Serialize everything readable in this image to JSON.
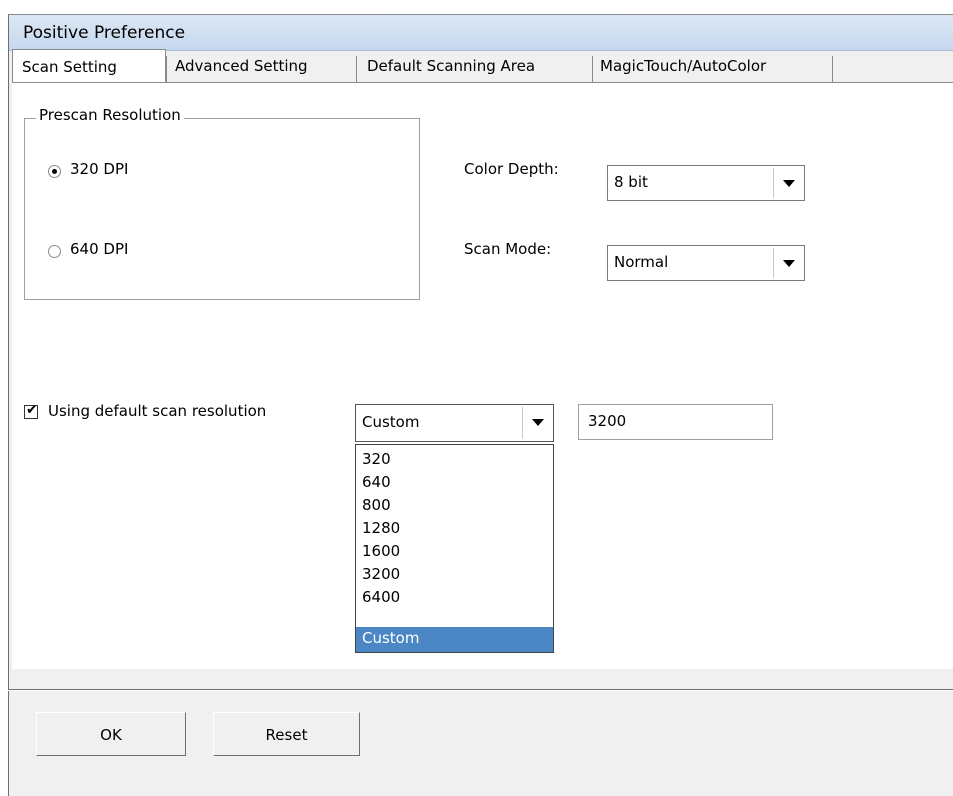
{
  "window": {
    "title": "Positive Preference"
  },
  "tabs": [
    {
      "label": "Scan Setting",
      "active": true
    },
    {
      "label": "Advanced Setting",
      "active": false
    },
    {
      "label": "Default Scanning Area",
      "active": false
    },
    {
      "label": "MagicTouch/AutoColor",
      "active": false
    }
  ],
  "prescan": {
    "group_label": "Prescan Resolution",
    "options": [
      {
        "label": "320 DPI",
        "selected": true
      },
      {
        "label": "640 DPI",
        "selected": false
      }
    ]
  },
  "color_depth": {
    "label": "Color Depth:",
    "value": "8 bit"
  },
  "scan_mode": {
    "label": "Scan Mode:",
    "value": "Normal"
  },
  "default_resolution": {
    "checkbox_label": "Using default scan resolution",
    "checked": true,
    "combo_value": "Custom",
    "custom_value": "3200",
    "options": [
      "320",
      "640",
      "800",
      "1280",
      "1600",
      "3200",
      "6400",
      "Custom"
    ],
    "highlighted_option": "Custom"
  },
  "buttons": {
    "ok": "OK",
    "reset": "Reset"
  },
  "colors": {
    "selection": "#4a87c4",
    "titlebar": "#c6d8ee"
  }
}
